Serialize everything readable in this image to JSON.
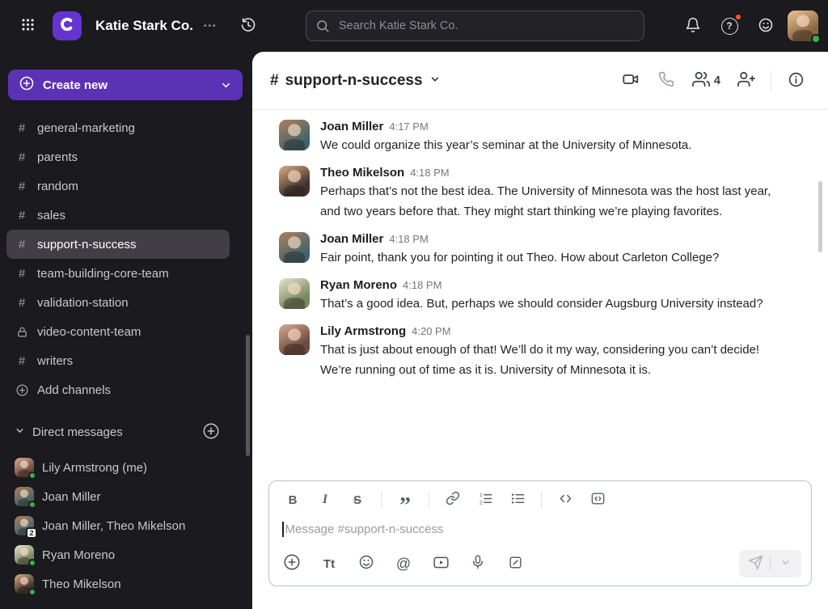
{
  "topbar": {
    "workspace_name": "Katie Stark Co.",
    "workspace_menu": "•••",
    "search_placeholder": "Search Katie Stark Co.",
    "avatar": "user"
  },
  "icons": {
    "hash": "#",
    "help": "?",
    "bold": "B",
    "italic": "I",
    "strikethrough": "S",
    "quote": "”",
    "text_format": "Tt",
    "mention": "@"
  },
  "sidebar": {
    "create_new": "Create new",
    "channels": [
      {
        "name": "general-marketing"
      },
      {
        "name": "parents"
      },
      {
        "name": "random"
      },
      {
        "name": "sales"
      },
      {
        "name": "support-n-success",
        "selected": true
      },
      {
        "name": "team-building-core-team"
      },
      {
        "name": "validation-station"
      },
      {
        "name": "video-content-team",
        "locked": true
      },
      {
        "name": "writers"
      }
    ],
    "add_channels": "Add channels",
    "dm_header": "Direct messages",
    "dms": [
      {
        "name": "Lily Armstrong (me)",
        "avatar": "lily",
        "status": "online"
      },
      {
        "name": "Joan Miller",
        "avatar": "joan",
        "status": "online"
      },
      {
        "name": "Joan Miller, Theo Mikelson",
        "avatar": "joan",
        "badge": "2"
      },
      {
        "name": "Ryan Moreno",
        "avatar": "ryan",
        "status": "online"
      },
      {
        "name": "Theo Mikelson",
        "avatar": "theo",
        "status": "online"
      }
    ]
  },
  "channel_header": {
    "title": "support-n-success",
    "member_count": "4"
  },
  "messages": [
    {
      "author": "Joan Miller",
      "time": "4:17 PM",
      "avatar": "joan",
      "text": "We could organize this year’s seminar at the University of Minnesota."
    },
    {
      "author": "Theo Mikelson",
      "time": "4:18 PM",
      "avatar": "theo",
      "text": "Perhaps that’s not the best idea. The University of Minnesota was the host last year, and two years before that. They might start thinking we’re playing favorites."
    },
    {
      "author": "Joan Miller",
      "time": "4:18 PM",
      "avatar": "joan",
      "text": "Fair point, thank you for pointing it out Theo. How about Carleton College?"
    },
    {
      "author": "Ryan Moreno",
      "time": "4:18 PM",
      "avatar": "ryan",
      "text": "That’s a good idea. But, perhaps we should consider Augsburg University instead?"
    },
    {
      "author": "Lily Armstrong",
      "time": "4:20 PM",
      "avatar": "lily",
      "text": "That is just about enough of that! We’ll do it my way, considering you can’t decide! We’re running out of time as it is. University of Minnesota it is."
    }
  ],
  "composer": {
    "placeholder": "Message #support-n-success"
  },
  "colors": {
    "brand_purple": "#6434d1",
    "button_purple": "#5b32b4",
    "presence_green": "#34b24a",
    "notification_orange": "#f45b2c",
    "selected_channel_bg": "#413f45",
    "composer_border": "#b7c0d8",
    "topbar_bg": "#1b1a1e"
  }
}
